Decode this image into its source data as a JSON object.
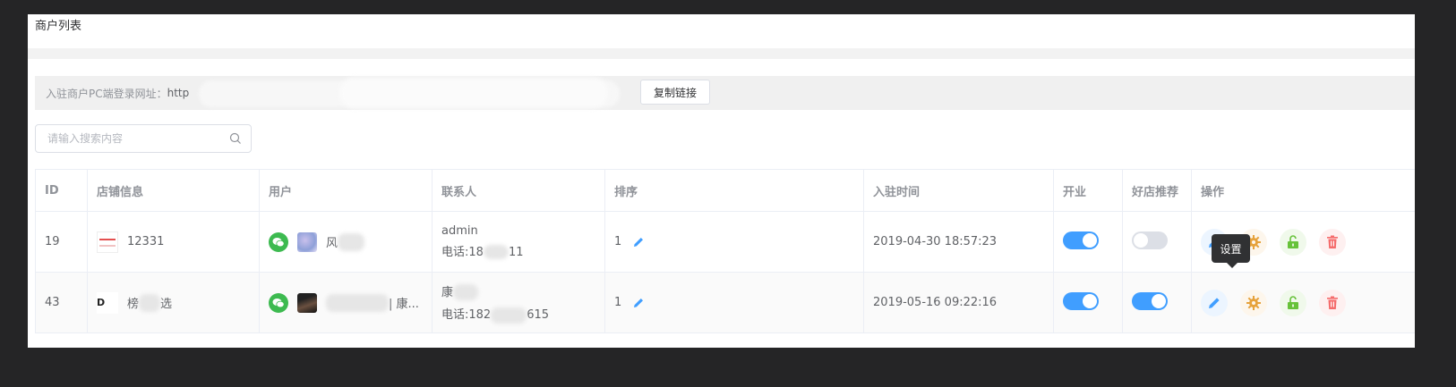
{
  "page": {
    "title": "商户列表"
  },
  "url_bar": {
    "label": "入驻商户PC端登录网址：",
    "url_prefix": "http",
    "copy_button": "复制链接"
  },
  "search": {
    "placeholder": "请输入搜索内容"
  },
  "table": {
    "columns": [
      "ID",
      "店铺信息",
      "用户",
      "联系人",
      "排序",
      "入驻时间",
      "开业",
      "好店推荐",
      "操作"
    ],
    "rows": [
      {
        "id": "19",
        "shop_name": "12331",
        "user_name": "风",
        "contact_name": "admin",
        "contact_phone": "电话:18",
        "contact_phone_tail": "11",
        "sort": "1",
        "joined_at": "2019-04-30 18:57:23",
        "open": true,
        "recommended": false
      },
      {
        "id": "43",
        "shop_name_start": "榜",
        "shop_name_end": "选",
        "shop_logo_text": "D",
        "user_name_tail": "| 康...",
        "contact_name": "康",
        "contact_phone": "电话:182",
        "contact_phone_tail": "615",
        "sort": "1",
        "joined_at": "2019-05-16 09:22:16",
        "open": true,
        "recommended": true
      }
    ]
  },
  "tooltip": {
    "text": "设置"
  },
  "colors": {
    "primary": "#409eff",
    "warning": "#e6a23c",
    "success": "#67c23a",
    "danger": "#f56c6c",
    "wechat": "#3dba50"
  },
  "icons": {
    "edit": "pencil-icon",
    "settings": "gear-icon",
    "unlock": "unlock-icon",
    "delete": "trash-icon",
    "search": "search-icon",
    "wechat": "wechat-icon"
  }
}
